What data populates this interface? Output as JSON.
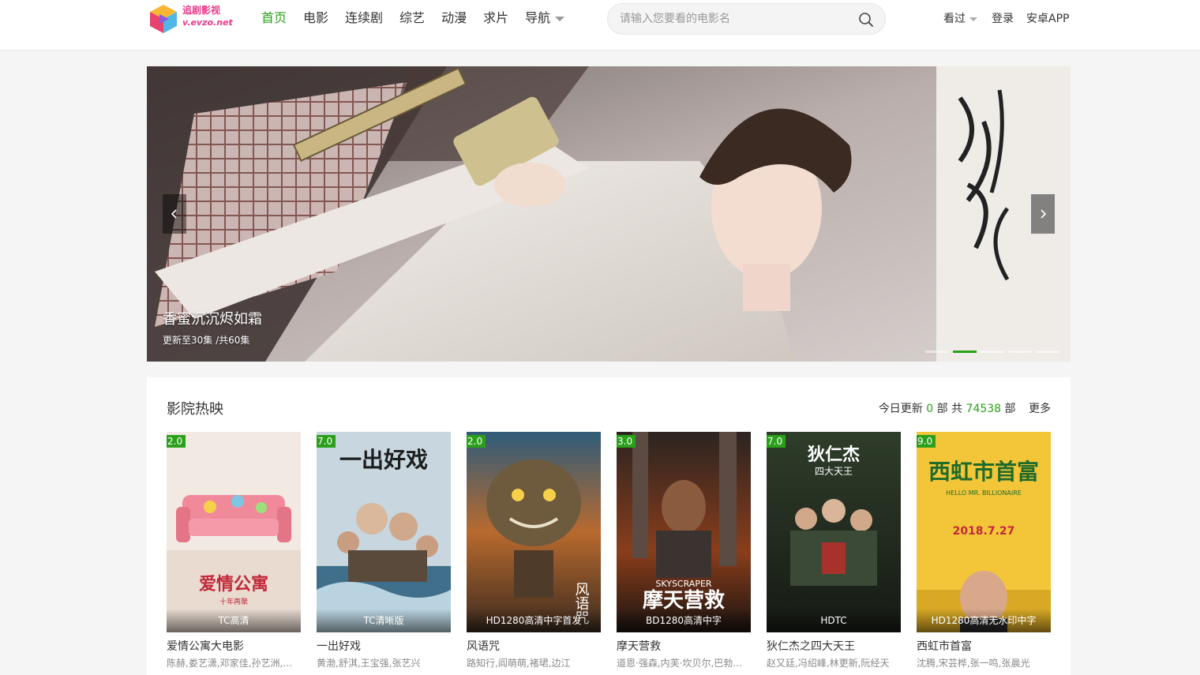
{
  "header": {
    "logo": {
      "line1": "追剧影视",
      "line2": "v.evzo.net"
    },
    "nav": [
      {
        "label": "首页",
        "active": true
      },
      {
        "label": "电影"
      },
      {
        "label": "连续剧"
      },
      {
        "label": "综艺"
      },
      {
        "label": "动漫"
      },
      {
        "label": "求片"
      },
      {
        "label": "导航",
        "dropdown": true
      }
    ],
    "search": {
      "placeholder": "请输入您要看的电影名",
      "value": ""
    },
    "right": {
      "history": "看过",
      "login": "登录",
      "app": "安卓APP"
    }
  },
  "banner": {
    "title": "香蜜沉沉烬如霜",
    "subtitle": "更新至30集 /共60集",
    "slide_count": 5,
    "active_slide": 2
  },
  "hot": {
    "title": "影院热映",
    "today_label": "今日更新",
    "today_count": "0",
    "unit": "部",
    "total_label": "共",
    "total_count": "74538",
    "more": "更多",
    "movies": [
      {
        "score": "2.0",
        "quality": "TC高清",
        "title": "爱情公寓大电影",
        "cast": "陈赫,娄艺潇,邓家佳,孙艺洲,李金铭"
      },
      {
        "score": "7.0",
        "quality": "TC清晰版",
        "title": "一出好戏",
        "cast": "黄渤,舒淇,王宝强,张艺兴"
      },
      {
        "score": "2.0",
        "quality": "HD1280高清中字首发",
        "title": "风语咒",
        "cast": "路知行,阎萌萌,褚珺,边江"
      },
      {
        "score": "3.0",
        "quality": "BD1280高清中字",
        "title": "摩天营救",
        "cast": "道恩·强森,内芙·坎贝尔,巴勃罗·施瑞柏"
      },
      {
        "score": "7.0",
        "quality": "HDTC",
        "title": "狄仁杰之四大天王",
        "cast": "赵又廷,冯绍峰,林更新,阮经天"
      },
      {
        "score": "9.0",
        "quality": "HD1280高清无水印中字",
        "title": "西虹市首富",
        "cast": "沈腾,宋芸桦,张一鸣,张晨光"
      }
    ]
  },
  "colors": {
    "accent": "#2aa01b",
    "page_bg": "#f5f5f5",
    "brand_pink": "#e83a8a"
  }
}
